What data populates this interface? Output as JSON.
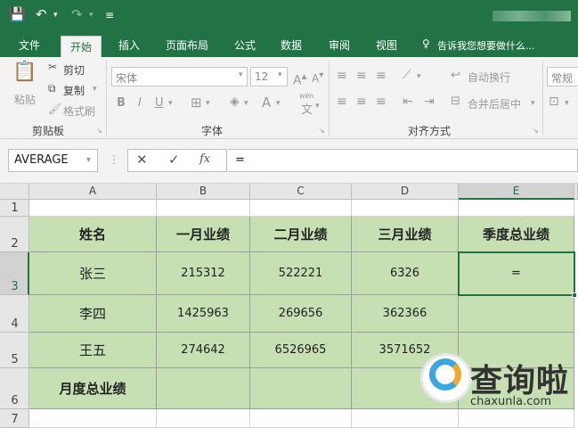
{
  "quick_access": {
    "save_icon": "💾",
    "undo_icon": "↶",
    "redo_icon": "↷",
    "customize_icon": "≡"
  },
  "tabs": [
    "文件",
    "开始",
    "插入",
    "页面布局",
    "公式",
    "数据",
    "审阅",
    "视图"
  ],
  "tell_me": "告诉我您想要做什么...",
  "clipboard": {
    "paste": "粘贴",
    "cut": "剪切",
    "copy": "复制",
    "format_painter": "格式刷",
    "group": "剪贴板"
  },
  "font": {
    "name": "宋体",
    "size": "12",
    "bold": "B",
    "italic": "I",
    "underline": "U",
    "group": "字体",
    "font_color_label": "A",
    "wen_label": "wén",
    "wen_char": "文"
  },
  "alignment": {
    "wrap": "自动换行",
    "merge": "合并后居中",
    "group": "对齐方式"
  },
  "number": {
    "format": "常规"
  },
  "formula_bar": {
    "name_box": "AVERAGE",
    "cancel": "✕",
    "enter": "✓",
    "fx": "fx",
    "content": "="
  },
  "columns": [
    "A",
    "B",
    "C",
    "D",
    "E"
  ],
  "rows": [
    "1",
    "2",
    "3",
    "4",
    "5",
    "6",
    "7"
  ],
  "table": {
    "headers": [
      "姓名",
      "一月业绩",
      "二月业绩",
      "三月业绩",
      "季度总业绩"
    ],
    "data": [
      [
        "张三",
        "215312",
        "522221",
        "6326",
        "="
      ],
      [
        "李四",
        "1425963",
        "269656",
        "362366",
        ""
      ],
      [
        "王五",
        "274642",
        "6526965",
        "3571652",
        ""
      ]
    ],
    "footer": "月度总业绩"
  },
  "watermark": {
    "brand": "查询啦",
    "url": "chaxunla.com"
  },
  "colors": {
    "accent": "#217346",
    "cell_fill": "#c6e0b4"
  }
}
